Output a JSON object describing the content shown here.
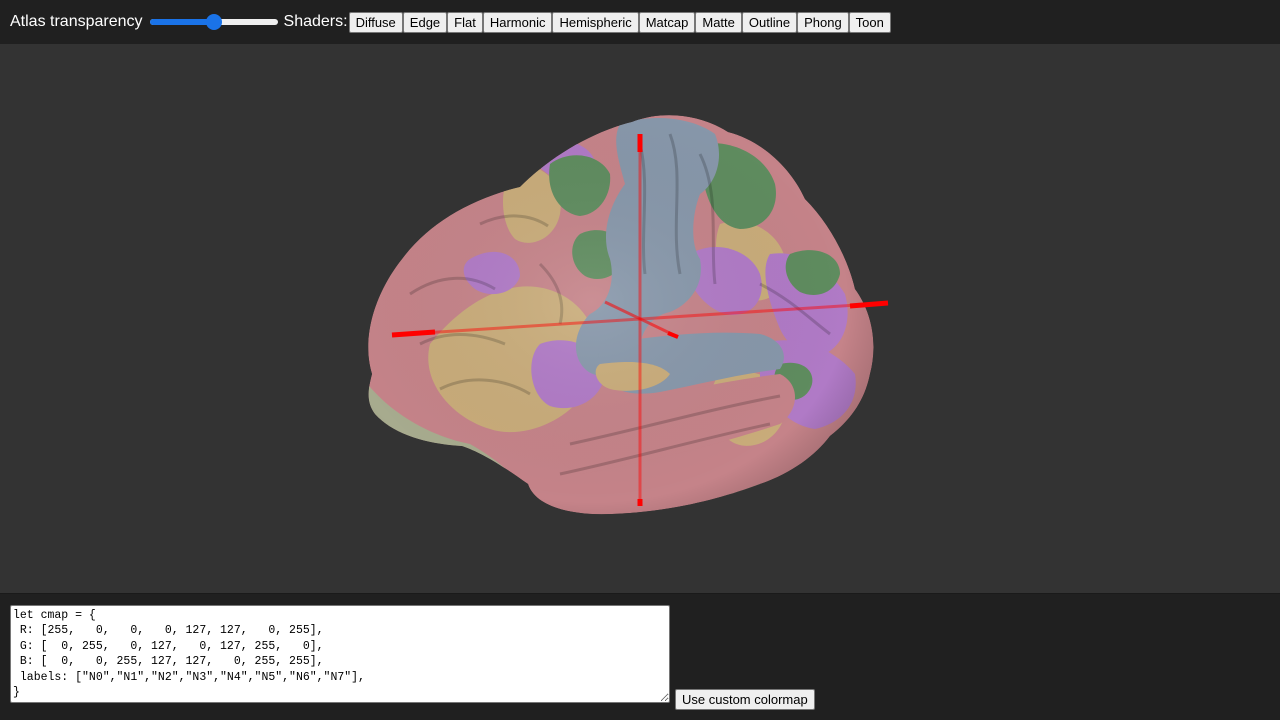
{
  "header": {
    "atlas_label": "Atlas transparency",
    "atlas_slider_value": 0.5,
    "shaders_label": "Shaders:",
    "shader_buttons": [
      "Diffuse",
      "Edge",
      "Flat",
      "Harmonic",
      "Hemispheric",
      "Matcap",
      "Matte",
      "Outline",
      "Phong",
      "Toon"
    ]
  },
  "viewer": {
    "background_color": "#333333",
    "crosshair_color": "#ff0000",
    "atlas_colors": [
      "#c58389",
      "#c9ac7a",
      "#8797aa",
      "#5f8c5f",
      "#b07ac6",
      "#a7ab8e"
    ]
  },
  "footer": {
    "cmap_text": "let cmap = {\n R: [255,   0,   0,   0, 127, 127,   0, 255],\n G: [  0, 255,   0, 127,   0, 127, 255,   0],\n B: [  0,   0, 255, 127, 127,   0, 255, 255],\n labels: [\"N0\",\"N1\",\"N2\",\"N3\",\"N4\",\"N5\",\"N6\",\"N7\"],\n}",
    "use_button": "Use custom colormap"
  }
}
